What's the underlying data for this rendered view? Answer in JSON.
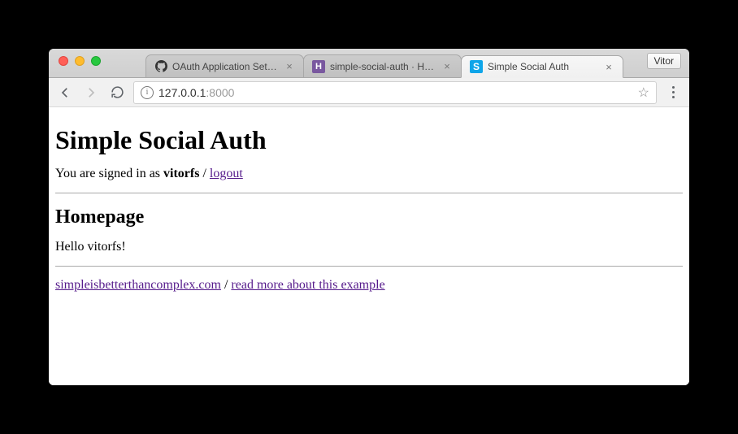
{
  "chrome": {
    "profile_name": "Vitor",
    "tabs": [
      {
        "title": "OAuth Application Settings",
        "favicon": "github"
      },
      {
        "title": "simple-social-auth · Heroku",
        "favicon": "heroku"
      },
      {
        "title": "Simple Social Auth",
        "favicon": "s"
      }
    ],
    "active_tab_index": 2,
    "url_host": "127.0.0.1",
    "url_port": ":8000"
  },
  "page": {
    "heading": "Simple Social Auth",
    "signed_in_prefix": "You are signed in as ",
    "username": "vitorfs",
    "separator": " / ",
    "logout_label": "logout",
    "subheading": "Homepage",
    "greeting": "Hello vitorfs!",
    "footer_link_1": "simpleisbetterthancomplex.com",
    "footer_sep": " / ",
    "footer_link_2": "read more about this example"
  }
}
